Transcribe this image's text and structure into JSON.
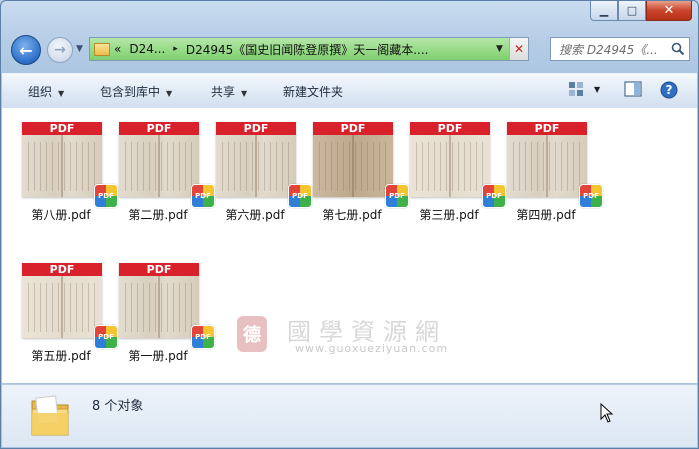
{
  "window": {
    "minimize_glyph": "▁",
    "maximize_glyph": "□",
    "close_glyph": "✕"
  },
  "nav": {
    "back_glyph": "←",
    "forward_glyph": "→",
    "history_caret": "▼"
  },
  "address": {
    "chevron": "«",
    "segments": [
      "D24...",
      "D24945《国史旧闻陈登原撰》天一阁藏本...."
    ],
    "separator": "▸",
    "dropdown_glyph": "▼",
    "clear_glyph": "✕"
  },
  "search": {
    "placeholder": "搜索 D24945《..."
  },
  "toolbar": {
    "organize": "组织",
    "include_in_library": "包含到库中",
    "share": "共享",
    "new_folder": "新建文件夹",
    "caret": "▼"
  },
  "files": [
    {
      "name": "第八册.pdf",
      "badge": "PDF",
      "band": "PDF",
      "tone": "normal"
    },
    {
      "name": "第二册.pdf",
      "badge": "PDF",
      "band": "PDF",
      "tone": "normal"
    },
    {
      "name": "第六册.pdf",
      "badge": "PDF",
      "band": "PDF",
      "tone": "normal"
    },
    {
      "name": "第七册.pdf",
      "badge": "PDF",
      "band": "PDF",
      "tone": "dark"
    },
    {
      "name": "第三册.pdf",
      "badge": "PDF",
      "band": "PDF",
      "tone": "light"
    },
    {
      "name": "第四册.pdf",
      "badge": "PDF",
      "band": "PDF",
      "tone": "normal"
    },
    {
      "name": "第五册.pdf",
      "badge": "PDF",
      "band": "PDF",
      "tone": "light"
    },
    {
      "name": "第一册.pdf",
      "badge": "PDF",
      "band": "PDF",
      "tone": "normal"
    }
  ],
  "watermark": {
    "seal": "德",
    "chinese": "國學資源網",
    "url": "www.guoxueziyuan.com"
  },
  "status": {
    "count_text": "8 个对象"
  },
  "colors": {
    "pdf_red": "#d9212c",
    "address_green": "#7ed06e",
    "close_red": "#c9442b"
  }
}
